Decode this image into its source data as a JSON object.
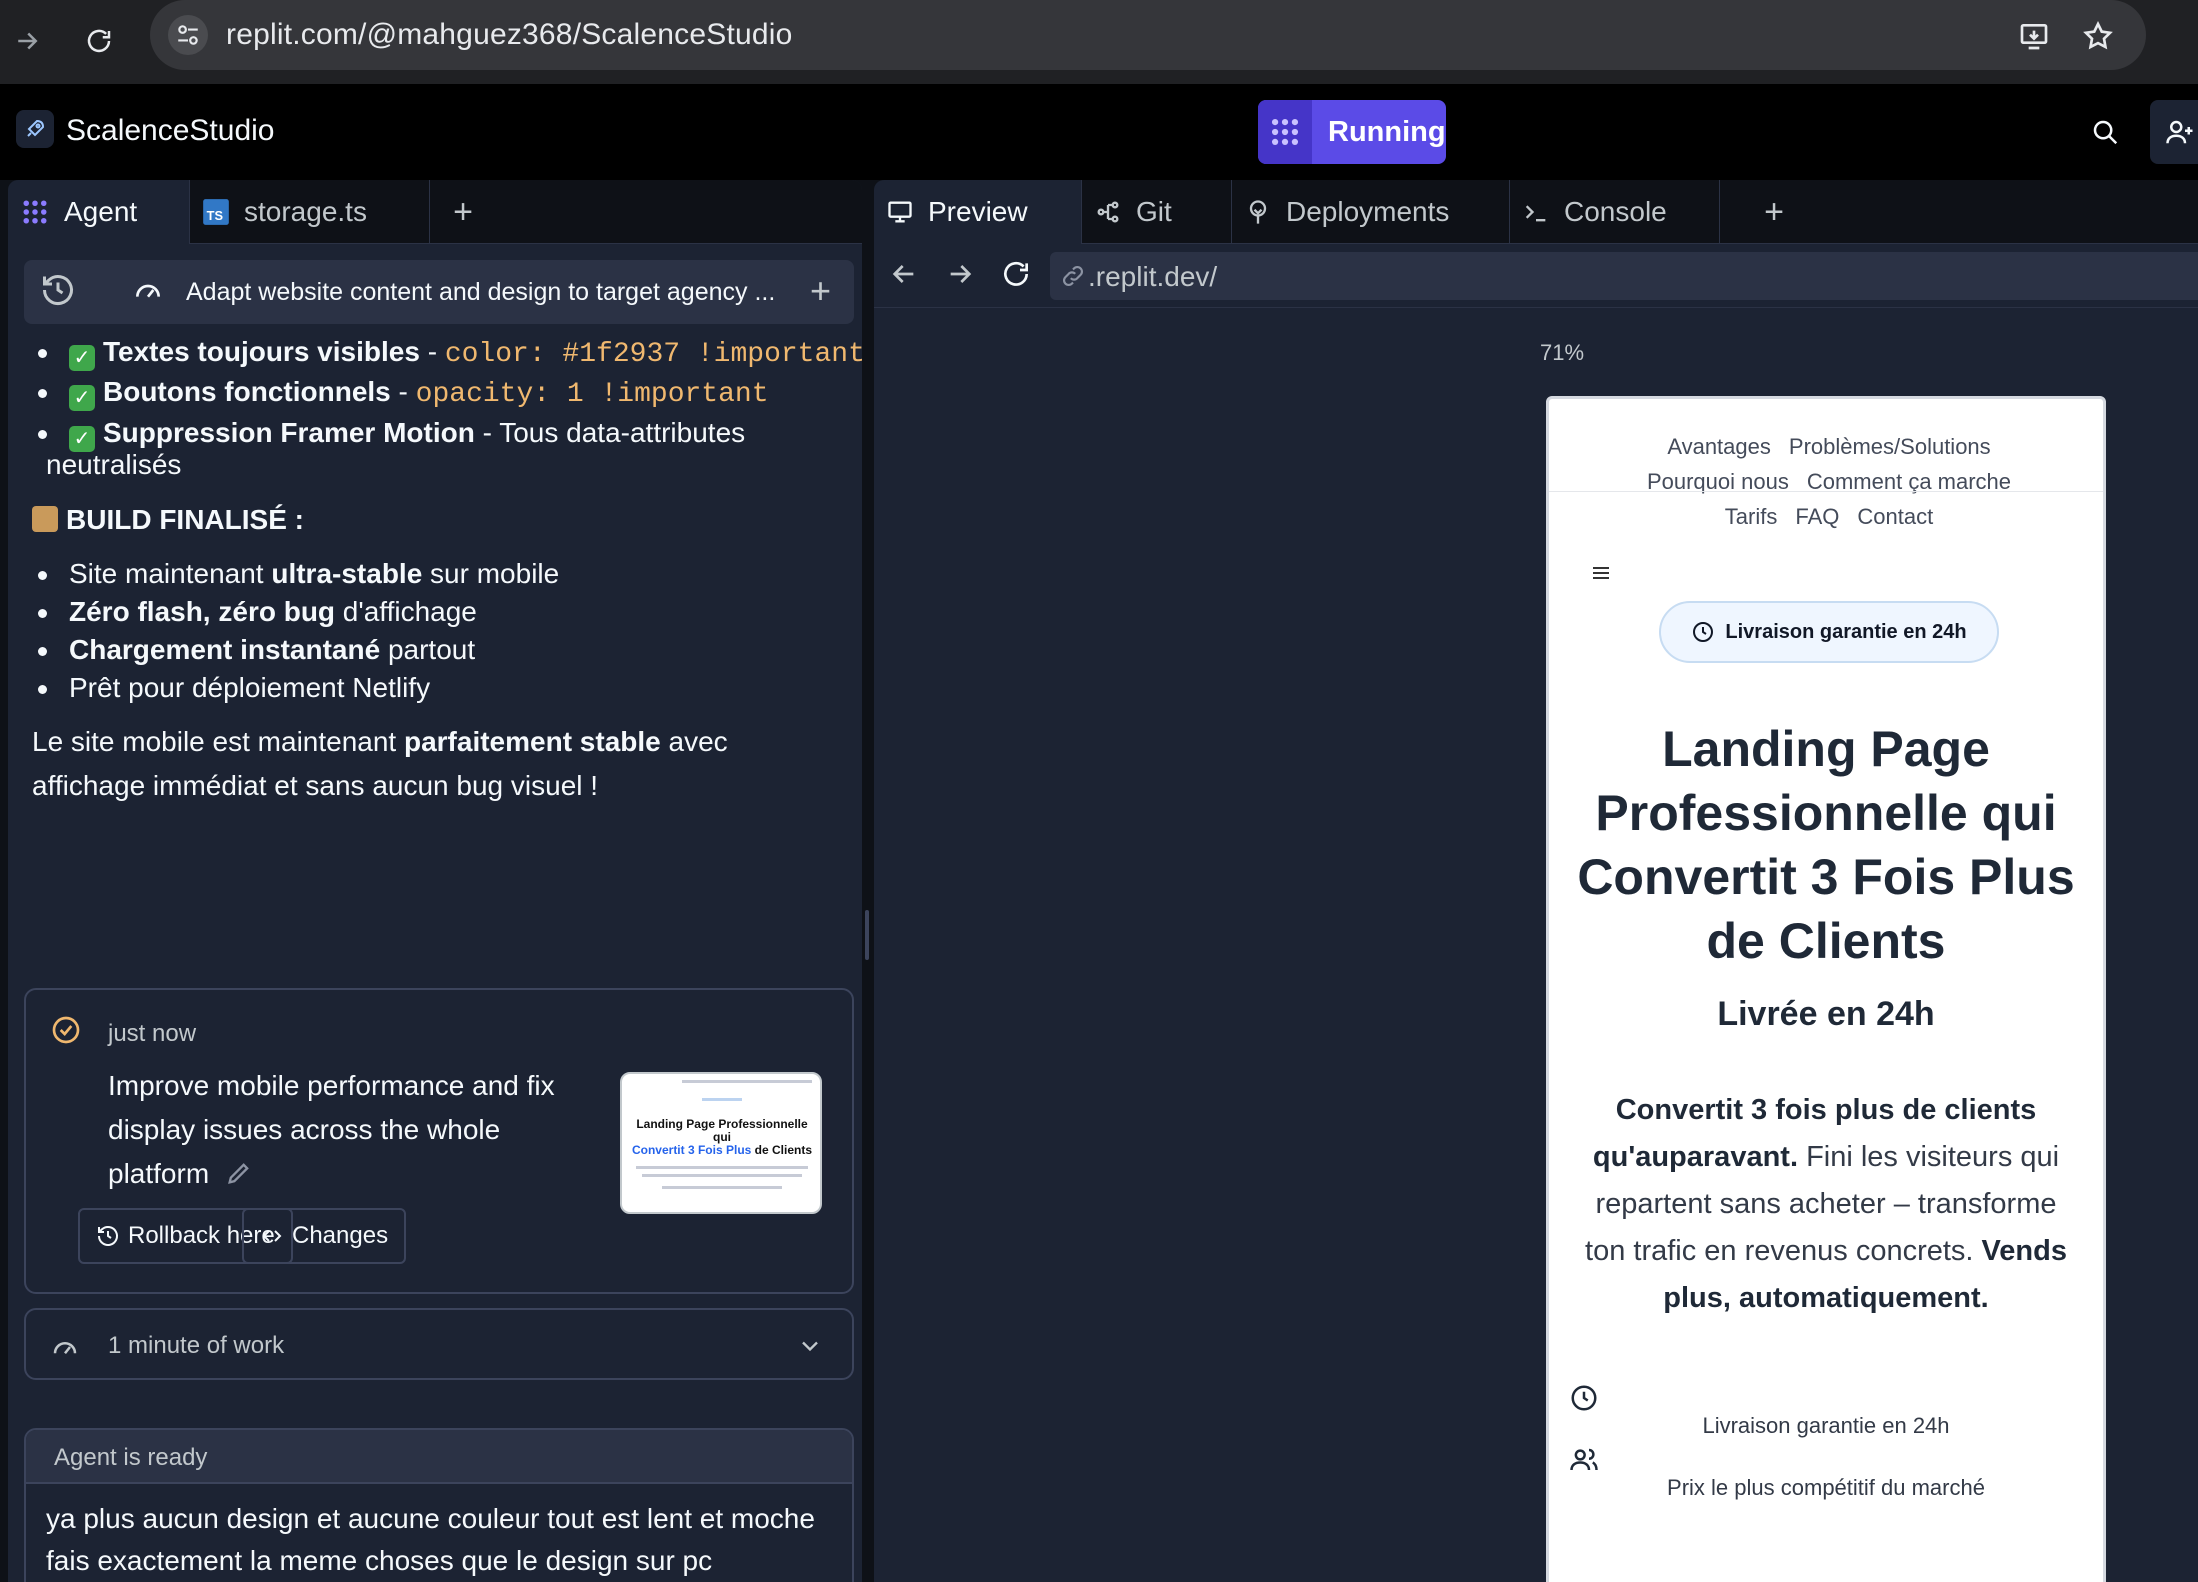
{
  "browser": {
    "url": "replit.com/@mahguez368/ScalenceStudio"
  },
  "app": {
    "name": "ScalenceStudio",
    "run_label": "Running"
  },
  "left_tabs": [
    {
      "label": "Agent",
      "icon": "agent-icon"
    },
    {
      "label": "storage.ts",
      "icon": "typescript-icon"
    }
  ],
  "agent": {
    "task_title": "Adapt website content and design to target agency ...",
    "bullets_top": [
      {
        "bold": "Textes toujours visibles",
        "sep": " - ",
        "code": "color: #1f2937 !important"
      },
      {
        "bold": "Boutons fonctionnels",
        "sep": " - ",
        "code": "opacity: 1 !important"
      },
      {
        "bold": "Suppression Framer Motion",
        "sep": " - ",
        "text": "Tous data-attributes",
        "text2": "neutralisés"
      }
    ],
    "build_heading": "BUILD FINALISÉ :",
    "bullets_build": [
      {
        "pre": "Site maintenant ",
        "bold": "ultra-stable",
        "post": " sur mobile"
      },
      {
        "pre": "",
        "bold": "Zéro flash, zéro bug",
        "post": " d'affichage"
      },
      {
        "pre": "",
        "bold": "Chargement instantané",
        "post": " partout"
      },
      {
        "pre": "Prêt pour déploiement Netlify",
        "bold": "",
        "post": ""
      }
    ],
    "summary_pre": "Le site mobile est maintenant ",
    "summary_bold": "parfaitement stable",
    "summary_post": " avec",
    "summary_line2": "affichage immédiat et sans aucun bug visuel !",
    "checkpoint": {
      "time": "just now",
      "message": "Improve mobile performance and fix display issues across the whole platform",
      "rollback_label": "Rollback here",
      "changes_label": "Changes",
      "thumb_title": "Landing Page Professionnelle qui",
      "thumb_title2_blue": "Convertit 3 Fois Plus",
      "thumb_title2_rest": " de Clients"
    },
    "work_label": "1 minute of work",
    "status": "Agent is ready",
    "input_text": "ya plus aucun design et aucune couleur tout est lent et moche fais exactement la meme choses que le design sur pc"
  },
  "right_tabs": [
    {
      "label": "Preview",
      "icon": "monitor-icon"
    },
    {
      "label": "Git",
      "icon": "git-icon"
    },
    {
      "label": "Deployments",
      "icon": "deployments-icon"
    },
    {
      "label": "Console",
      "icon": "terminal-icon"
    }
  ],
  "preview": {
    "url": ".replit.dev/",
    "zoom": "71%",
    "nav_row1": [
      "Avantages",
      "Problèmes/Solutions"
    ],
    "nav_row2": [
      "Pourquoi nous",
      "Comment ça marche"
    ],
    "nav_row3": [
      "Tarifs",
      "FAQ",
      "Contact"
    ],
    "pill": "Livraison garantie en 24h",
    "h1": "Landing Page Professionnelle qui Convertit 3 Fois Plus de Clients",
    "h2": "Livrée en 24h",
    "lead_bold1": "Convertit 3 fois plus de clients qu'auparavant.",
    "lead_text": " Fini les visiteurs qui repartent sans acheter – transforme ton trafic en revenus concrets. ",
    "lead_bold2": "Vends plus, automatiquement.",
    "feature1": "Livraison garantie en 24h",
    "feature2": "Prix le plus compétitif du marché"
  }
}
